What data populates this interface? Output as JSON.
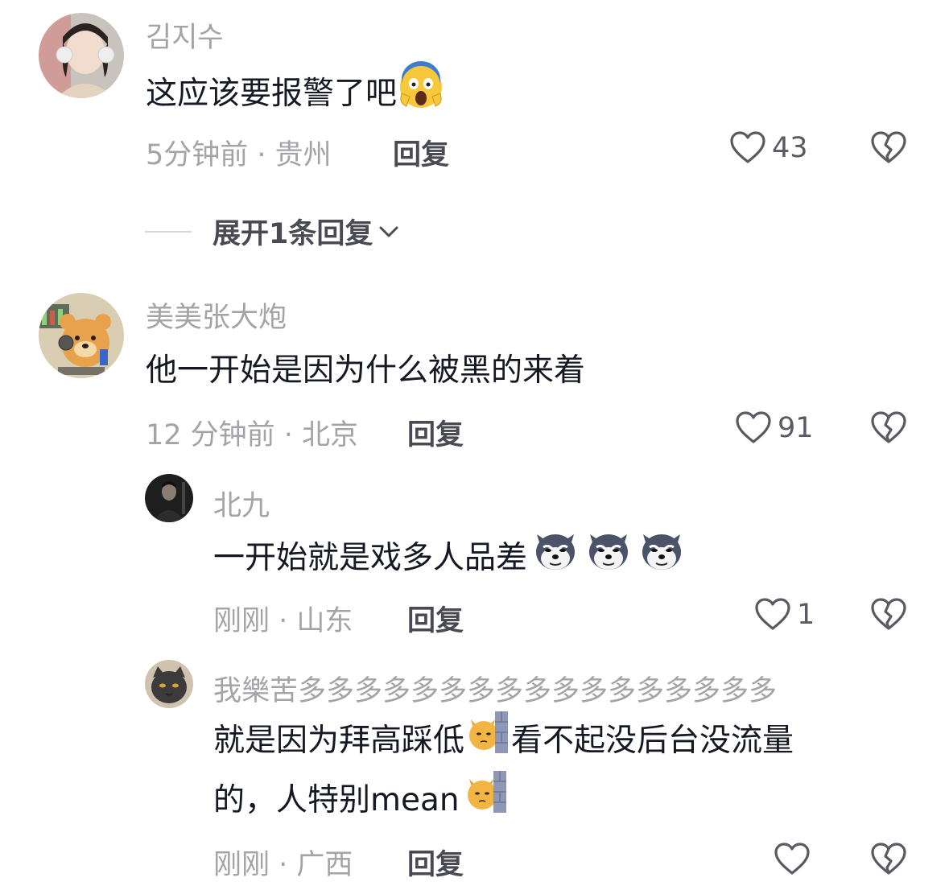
{
  "comments": [
    {
      "username": "김지수",
      "text": "这应该要报警了吧",
      "emoji": "screaming-face",
      "time_location": "5分钟前 · 贵州",
      "reply_label": "回复",
      "likes": "43"
    },
    {
      "username": "美美张大炮",
      "text": "他一开始是因为什么被黑的来着",
      "time_location": "12 分钟前 · 北京",
      "reply_label": "回复",
      "likes": "91",
      "avatar_caption": "拒絕上班小熊"
    }
  ],
  "expand_replies_label": "展开1条回复",
  "replies": [
    {
      "username": "北九",
      "text": "一开始就是戏多人品差",
      "emoji": "husky-dog",
      "time_location": "刚刚 · 山东",
      "reply_label": "回复",
      "likes": "1"
    },
    {
      "username": "我樂苦多多多多多多多多多多多多多多多多多",
      "text_line1": "就是因为拜高踩低",
      "text_line1b": "看不起没后台没流量",
      "text_line2": "的，人特别mean",
      "emoji": "cat-behind-wall",
      "time_location": "刚刚 · 广西",
      "reply_label": "回复"
    }
  ],
  "colors": {
    "username": "#a3a3a8",
    "text": "#161823",
    "meta": "#a3a3a8"
  }
}
